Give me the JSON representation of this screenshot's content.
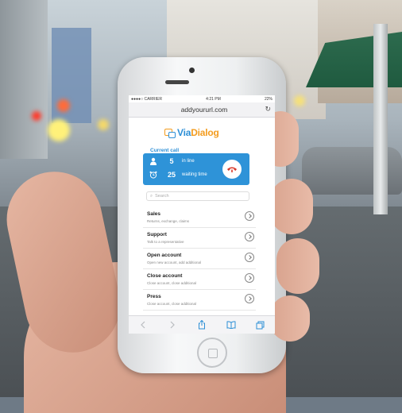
{
  "status_bar": {
    "carrier": "●●●●○ CARRIER",
    "time": "4:21 PM",
    "battery": "22%"
  },
  "browser": {
    "url": "addyoururl.com"
  },
  "app": {
    "logo_via": "Via",
    "logo_dialog": "Dialog",
    "current_call_title": "Current call",
    "in_line_count": "5",
    "in_line_label": "in line",
    "waiting_time_value": "25",
    "waiting_time_label": "waiting time",
    "search_placeholder": "Search"
  },
  "menu": [
    {
      "title": "Sales",
      "subtitle": "Returns, exchange, claims"
    },
    {
      "title": "Support",
      "subtitle": "Talk to a representative"
    },
    {
      "title": "Open account",
      "subtitle": "Open new account, add additional"
    },
    {
      "title": "Close account",
      "subtitle": "Close account, close additional"
    },
    {
      "title": "Press",
      "subtitle": "Close account, close additional"
    }
  ],
  "colors": {
    "brand_orange": "#f39c1f",
    "brand_blue": "#2d8fd6",
    "hangup_red": "#d93a2b"
  }
}
